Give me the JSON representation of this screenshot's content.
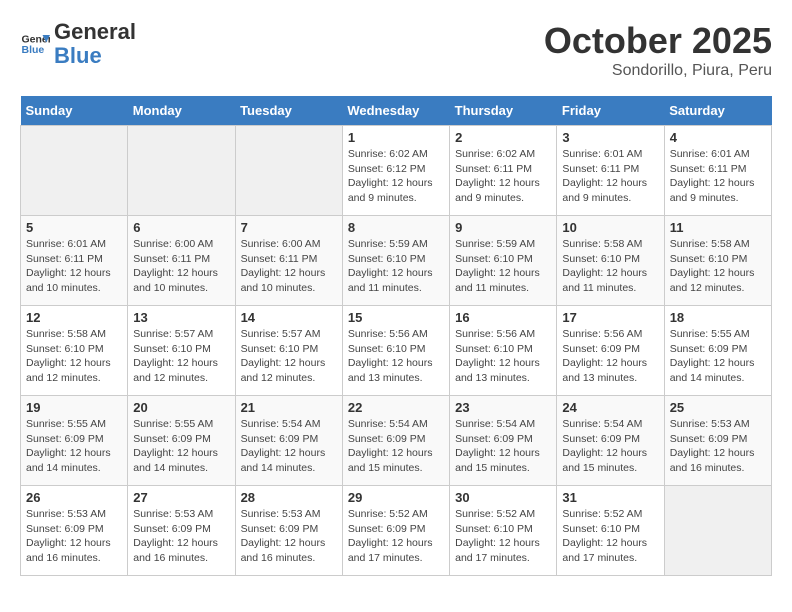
{
  "header": {
    "logo_line1": "General",
    "logo_line2": "Blue",
    "month": "October 2025",
    "location": "Sondorillo, Piura, Peru"
  },
  "weekdays": [
    "Sunday",
    "Monday",
    "Tuesday",
    "Wednesday",
    "Thursday",
    "Friday",
    "Saturday"
  ],
  "weeks": [
    [
      {
        "day": "",
        "info": ""
      },
      {
        "day": "",
        "info": ""
      },
      {
        "day": "",
        "info": ""
      },
      {
        "day": "1",
        "info": "Sunrise: 6:02 AM\nSunset: 6:12 PM\nDaylight: 12 hours and 9 minutes."
      },
      {
        "day": "2",
        "info": "Sunrise: 6:02 AM\nSunset: 6:11 PM\nDaylight: 12 hours and 9 minutes."
      },
      {
        "day": "3",
        "info": "Sunrise: 6:01 AM\nSunset: 6:11 PM\nDaylight: 12 hours and 9 minutes."
      },
      {
        "day": "4",
        "info": "Sunrise: 6:01 AM\nSunset: 6:11 PM\nDaylight: 12 hours and 9 minutes."
      }
    ],
    [
      {
        "day": "5",
        "info": "Sunrise: 6:01 AM\nSunset: 6:11 PM\nDaylight: 12 hours and 10 minutes."
      },
      {
        "day": "6",
        "info": "Sunrise: 6:00 AM\nSunset: 6:11 PM\nDaylight: 12 hours and 10 minutes."
      },
      {
        "day": "7",
        "info": "Sunrise: 6:00 AM\nSunset: 6:11 PM\nDaylight: 12 hours and 10 minutes."
      },
      {
        "day": "8",
        "info": "Sunrise: 5:59 AM\nSunset: 6:10 PM\nDaylight: 12 hours and 11 minutes."
      },
      {
        "day": "9",
        "info": "Sunrise: 5:59 AM\nSunset: 6:10 PM\nDaylight: 12 hours and 11 minutes."
      },
      {
        "day": "10",
        "info": "Sunrise: 5:58 AM\nSunset: 6:10 PM\nDaylight: 12 hours and 11 minutes."
      },
      {
        "day": "11",
        "info": "Sunrise: 5:58 AM\nSunset: 6:10 PM\nDaylight: 12 hours and 12 minutes."
      }
    ],
    [
      {
        "day": "12",
        "info": "Sunrise: 5:58 AM\nSunset: 6:10 PM\nDaylight: 12 hours and 12 minutes."
      },
      {
        "day": "13",
        "info": "Sunrise: 5:57 AM\nSunset: 6:10 PM\nDaylight: 12 hours and 12 minutes."
      },
      {
        "day": "14",
        "info": "Sunrise: 5:57 AM\nSunset: 6:10 PM\nDaylight: 12 hours and 12 minutes."
      },
      {
        "day": "15",
        "info": "Sunrise: 5:56 AM\nSunset: 6:10 PM\nDaylight: 12 hours and 13 minutes."
      },
      {
        "day": "16",
        "info": "Sunrise: 5:56 AM\nSunset: 6:10 PM\nDaylight: 12 hours and 13 minutes."
      },
      {
        "day": "17",
        "info": "Sunrise: 5:56 AM\nSunset: 6:09 PM\nDaylight: 12 hours and 13 minutes."
      },
      {
        "day": "18",
        "info": "Sunrise: 5:55 AM\nSunset: 6:09 PM\nDaylight: 12 hours and 14 minutes."
      }
    ],
    [
      {
        "day": "19",
        "info": "Sunrise: 5:55 AM\nSunset: 6:09 PM\nDaylight: 12 hours and 14 minutes."
      },
      {
        "day": "20",
        "info": "Sunrise: 5:55 AM\nSunset: 6:09 PM\nDaylight: 12 hours and 14 minutes."
      },
      {
        "day": "21",
        "info": "Sunrise: 5:54 AM\nSunset: 6:09 PM\nDaylight: 12 hours and 14 minutes."
      },
      {
        "day": "22",
        "info": "Sunrise: 5:54 AM\nSunset: 6:09 PM\nDaylight: 12 hours and 15 minutes."
      },
      {
        "day": "23",
        "info": "Sunrise: 5:54 AM\nSunset: 6:09 PM\nDaylight: 12 hours and 15 minutes."
      },
      {
        "day": "24",
        "info": "Sunrise: 5:54 AM\nSunset: 6:09 PM\nDaylight: 12 hours and 15 minutes."
      },
      {
        "day": "25",
        "info": "Sunrise: 5:53 AM\nSunset: 6:09 PM\nDaylight: 12 hours and 16 minutes."
      }
    ],
    [
      {
        "day": "26",
        "info": "Sunrise: 5:53 AM\nSunset: 6:09 PM\nDaylight: 12 hours and 16 minutes."
      },
      {
        "day": "27",
        "info": "Sunrise: 5:53 AM\nSunset: 6:09 PM\nDaylight: 12 hours and 16 minutes."
      },
      {
        "day": "28",
        "info": "Sunrise: 5:53 AM\nSunset: 6:09 PM\nDaylight: 12 hours and 16 minutes."
      },
      {
        "day": "29",
        "info": "Sunrise: 5:52 AM\nSunset: 6:09 PM\nDaylight: 12 hours and 17 minutes."
      },
      {
        "day": "30",
        "info": "Sunrise: 5:52 AM\nSunset: 6:10 PM\nDaylight: 12 hours and 17 minutes."
      },
      {
        "day": "31",
        "info": "Sunrise: 5:52 AM\nSunset: 6:10 PM\nDaylight: 12 hours and 17 minutes."
      },
      {
        "day": "",
        "info": ""
      }
    ]
  ]
}
